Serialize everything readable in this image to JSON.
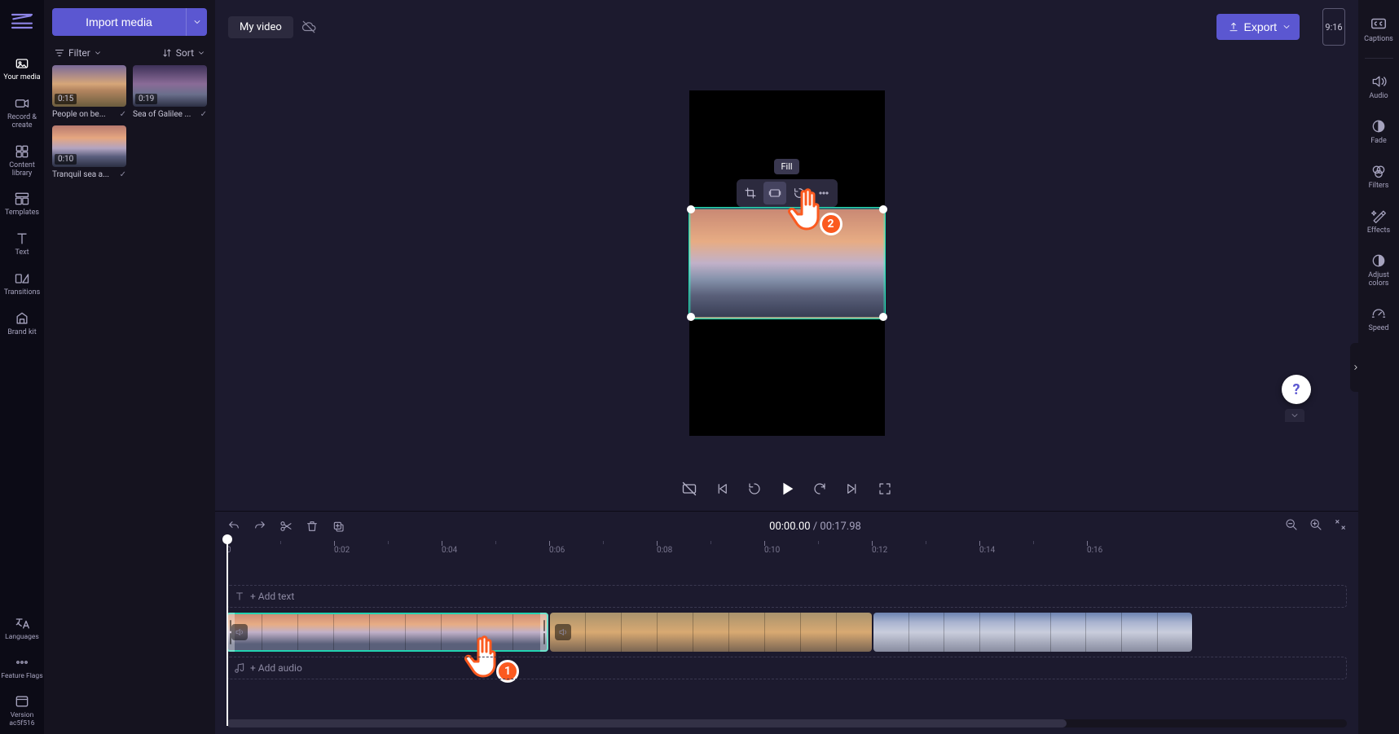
{
  "header": {
    "import_label": "Import media",
    "title": "My video",
    "export_label": "Export",
    "aspect_label": "9:16"
  },
  "rail": {
    "items": [
      "Your media",
      "Record & create",
      "Content library",
      "Templates",
      "Text",
      "Transitions",
      "Brand kit"
    ],
    "bottom": [
      "Languages",
      "Feature Flags",
      "Version ac5f516"
    ]
  },
  "right_rail": {
    "top": "Captions",
    "items": [
      "Audio",
      "Fade",
      "Filters",
      "Effects",
      "Adjust colors",
      "Speed"
    ]
  },
  "media_toolbar": {
    "filter": "Filter",
    "sort": "Sort"
  },
  "media": [
    {
      "duration": "0:15",
      "name": "People on be..."
    },
    {
      "duration": "0:19",
      "name": "Sea of Galilee ..."
    },
    {
      "duration": "0:10",
      "name": "Tranquil sea a..."
    }
  ],
  "floating_toolbar": {
    "tooltip": "Fill"
  },
  "annotations": {
    "hand1": "1",
    "hand2": "2"
  },
  "timeline": {
    "time_current": "00:00.00",
    "time_sep": " / ",
    "time_total": "00:17.98",
    "ticks": [
      "0",
      "0:02",
      "0:04",
      "0:06",
      "0:08",
      "0:10",
      "0:12",
      "0:14",
      "0:16"
    ],
    "add_text": "+ Add text",
    "add_audio": "+ Add audio"
  }
}
